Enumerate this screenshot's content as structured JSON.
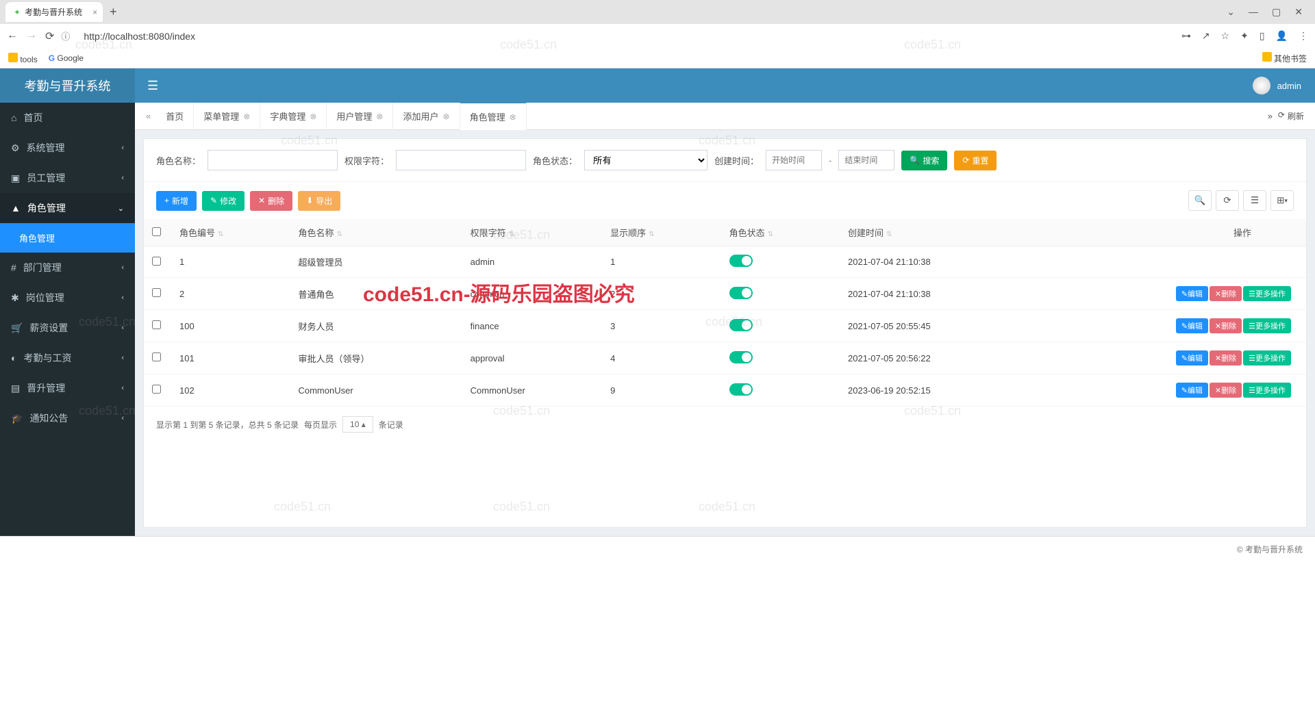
{
  "browser": {
    "tab_title": "考勤与晋升系统",
    "url": "http://localhost:8080/index",
    "bookmarks": {
      "tools": "tools",
      "google": "Google",
      "other": "其他书签"
    }
  },
  "header": {
    "app_title": "考勤与晋升系统",
    "user": "admin"
  },
  "sidebar": {
    "items": [
      {
        "label": "首页",
        "icon": "home"
      },
      {
        "label": "系统管理",
        "icon": "gear"
      },
      {
        "label": "员工管理",
        "icon": "user"
      },
      {
        "label": "角色管理",
        "icon": "role",
        "open": true,
        "sub": [
          {
            "label": "角色管理"
          }
        ]
      },
      {
        "label": "部门管理",
        "icon": "hash"
      },
      {
        "label": "岗位管理",
        "icon": "star"
      },
      {
        "label": "薪资设置",
        "icon": "cart"
      },
      {
        "label": "考勤与工资",
        "icon": "clock"
      },
      {
        "label": "晋升管理",
        "icon": "bars"
      },
      {
        "label": "通知公告",
        "icon": "grad"
      }
    ]
  },
  "tabs": {
    "items": [
      "首页",
      "菜单管理",
      "字典管理",
      "用户管理",
      "添加用户",
      "角色管理"
    ],
    "active_index": 5,
    "refresh": "刷新"
  },
  "search": {
    "role_name_label": "角色名称：",
    "perm_char_label": "权限字符：",
    "status_label": "角色状态：",
    "status_value": "所有",
    "create_time_label": "创建时间：",
    "start_placeholder": "开始时间",
    "end_placeholder": "结束时间",
    "search_btn": "搜索",
    "reset_btn": "重置"
  },
  "toolbar": {
    "add": "新增",
    "edit": "修改",
    "delete": "删除",
    "export": "导出"
  },
  "table": {
    "headers": [
      "角色编号",
      "角色名称",
      "权限字符",
      "显示顺序",
      "角色状态",
      "创建时间",
      "操作"
    ],
    "rows": [
      {
        "id": "1",
        "name": "超级管理员",
        "perm": "admin",
        "order": "1",
        "status": true,
        "created": "2021-07-04 21:10:38",
        "ops": false
      },
      {
        "id": "2",
        "name": "普通角色",
        "perm": "common",
        "order": "2",
        "status": true,
        "created": "2021-07-04 21:10:38",
        "ops": true
      },
      {
        "id": "100",
        "name": "财务人员",
        "perm": "finance",
        "order": "3",
        "status": true,
        "created": "2021-07-05 20:55:45",
        "ops": true
      },
      {
        "id": "101",
        "name": "审批人员（领导）",
        "perm": "approval",
        "order": "4",
        "status": true,
        "created": "2021-07-05 20:56:22",
        "ops": true
      },
      {
        "id": "102",
        "name": "CommonUser",
        "perm": "CommonUser",
        "order": "9",
        "status": true,
        "created": "2023-06-19 20:52:15",
        "ops": true
      }
    ],
    "ops": {
      "edit": "编辑",
      "delete": "删除",
      "more": "更多操作"
    }
  },
  "pagination": {
    "text_prefix": "显示第 1 到第 5 条记录，总共 5 条记录",
    "per_page_label": "每页显示",
    "per_page_value": "10",
    "records_suffix": "条记录"
  },
  "footer": {
    "copyright": "© 考勤与晋升系统"
  },
  "watermark_text": "code51.cn",
  "big_watermark": "code51.cn-源码乐园盗图必究"
}
